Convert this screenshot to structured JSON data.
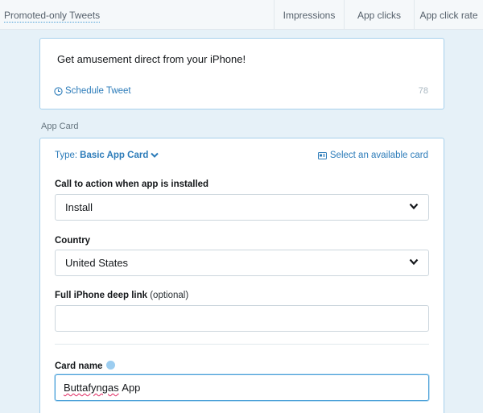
{
  "header": {
    "title": "Promoted-only Tweets",
    "columns": [
      "Impressions",
      "App clicks",
      "App click rate"
    ]
  },
  "tweet": {
    "text": "Get amusement direct from your iPhone!",
    "schedule_label": "Schedule Tweet",
    "char_count": "78"
  },
  "app_card": {
    "section_label": "App Card",
    "type_prefix": "Type:",
    "type_value": "Basic App Card",
    "select_card_label": "Select an available card",
    "cta": {
      "label": "Call to action when app is installed",
      "value": "Install"
    },
    "country": {
      "label": "Country",
      "value": "United States"
    },
    "deep_link": {
      "label": "Full iPhone deep link",
      "optional": "(optional)",
      "value": ""
    },
    "card_name": {
      "label": "Card name",
      "value_word1": "Buttafyngas",
      "value_word2": "App"
    }
  },
  "colors": {
    "accent": "#2b7bb9",
    "focus_border": "#4aa0d8",
    "background": "#e6f1f8"
  }
}
